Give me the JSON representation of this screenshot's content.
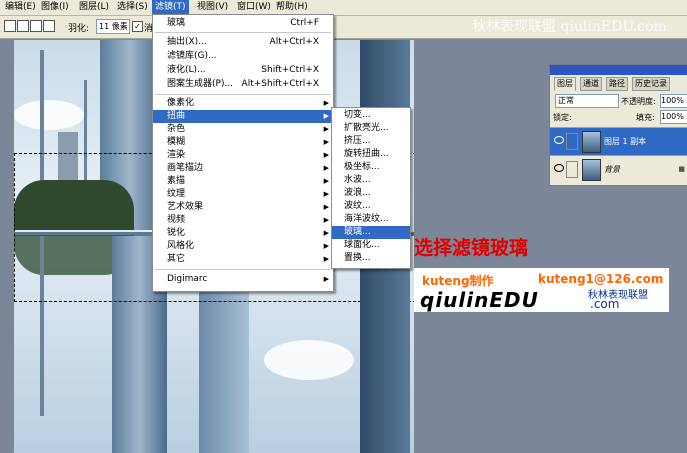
{
  "menubar": {
    "items": [
      {
        "label": "编辑(E)"
      },
      {
        "label": "图像(I)"
      },
      {
        "label": "图层(L)"
      },
      {
        "label": "选择(S)"
      },
      {
        "label": "滤镜(T)"
      },
      {
        "label": "视图(V)"
      },
      {
        "label": "窗口(W)"
      },
      {
        "label": "帮助(H)"
      }
    ]
  },
  "toolbar": {
    "feather_label": "羽化:",
    "feather_value": "11 像素",
    "antialias_label": "消除"
  },
  "watermark_top": "秋林表现联盟 qiulinEDU.com",
  "filter_menu": {
    "items": [
      {
        "label": "玻璃",
        "shortcut": "Ctrl+F"
      },
      {
        "label": "抽出(X)...",
        "shortcut": "Alt+Ctrl+X"
      },
      {
        "label": "滤镜库(G)..."
      },
      {
        "label": "液化(L)...",
        "shortcut": "Shift+Ctrl+X"
      },
      {
        "label": "图案生成器(P)...",
        "shortcut": "Alt+Shift+Ctrl+X"
      },
      {
        "label": "像素化"
      },
      {
        "label": "扭曲"
      },
      {
        "label": "杂色"
      },
      {
        "label": "模糊"
      },
      {
        "label": "渲染"
      },
      {
        "label": "画笔描边"
      },
      {
        "label": "素描"
      },
      {
        "label": "纹理"
      },
      {
        "label": "艺术效果"
      },
      {
        "label": "视频"
      },
      {
        "label": "锐化"
      },
      {
        "label": "风格化"
      },
      {
        "label": "其它"
      },
      {
        "label": "Digimarc"
      }
    ]
  },
  "distort_menu": {
    "items": [
      {
        "label": "切变..."
      },
      {
        "label": "扩散亮光..."
      },
      {
        "label": "挤压..."
      },
      {
        "label": "旋转扭曲..."
      },
      {
        "label": "极坐标..."
      },
      {
        "label": "水波..."
      },
      {
        "label": "波浪..."
      },
      {
        "label": "波纹..."
      },
      {
        "label": "海洋波纹..."
      },
      {
        "label": "玻璃..."
      },
      {
        "label": "球面化..."
      },
      {
        "label": "置换..."
      }
    ]
  },
  "instruction": "选择滤镜玻璃",
  "author": {
    "name": "kuteng制作",
    "email": "kuteng1@126.com",
    "brand": "qiulinEDU",
    "brand_suffix": ".com",
    "brand_cn": "秋林表现联盟"
  },
  "layers_panel": {
    "tabs": [
      "图层",
      "通道",
      "路径",
      "历史记录"
    ],
    "blend_mode": "正常",
    "opacity_label": "不透明度:",
    "opacity_value": "100%",
    "lock_label": "锁定:",
    "fill_label": "填充:",
    "fill_value": "100%",
    "layers": [
      {
        "name": "图层 1 副本"
      },
      {
        "name": "背景"
      }
    ]
  }
}
